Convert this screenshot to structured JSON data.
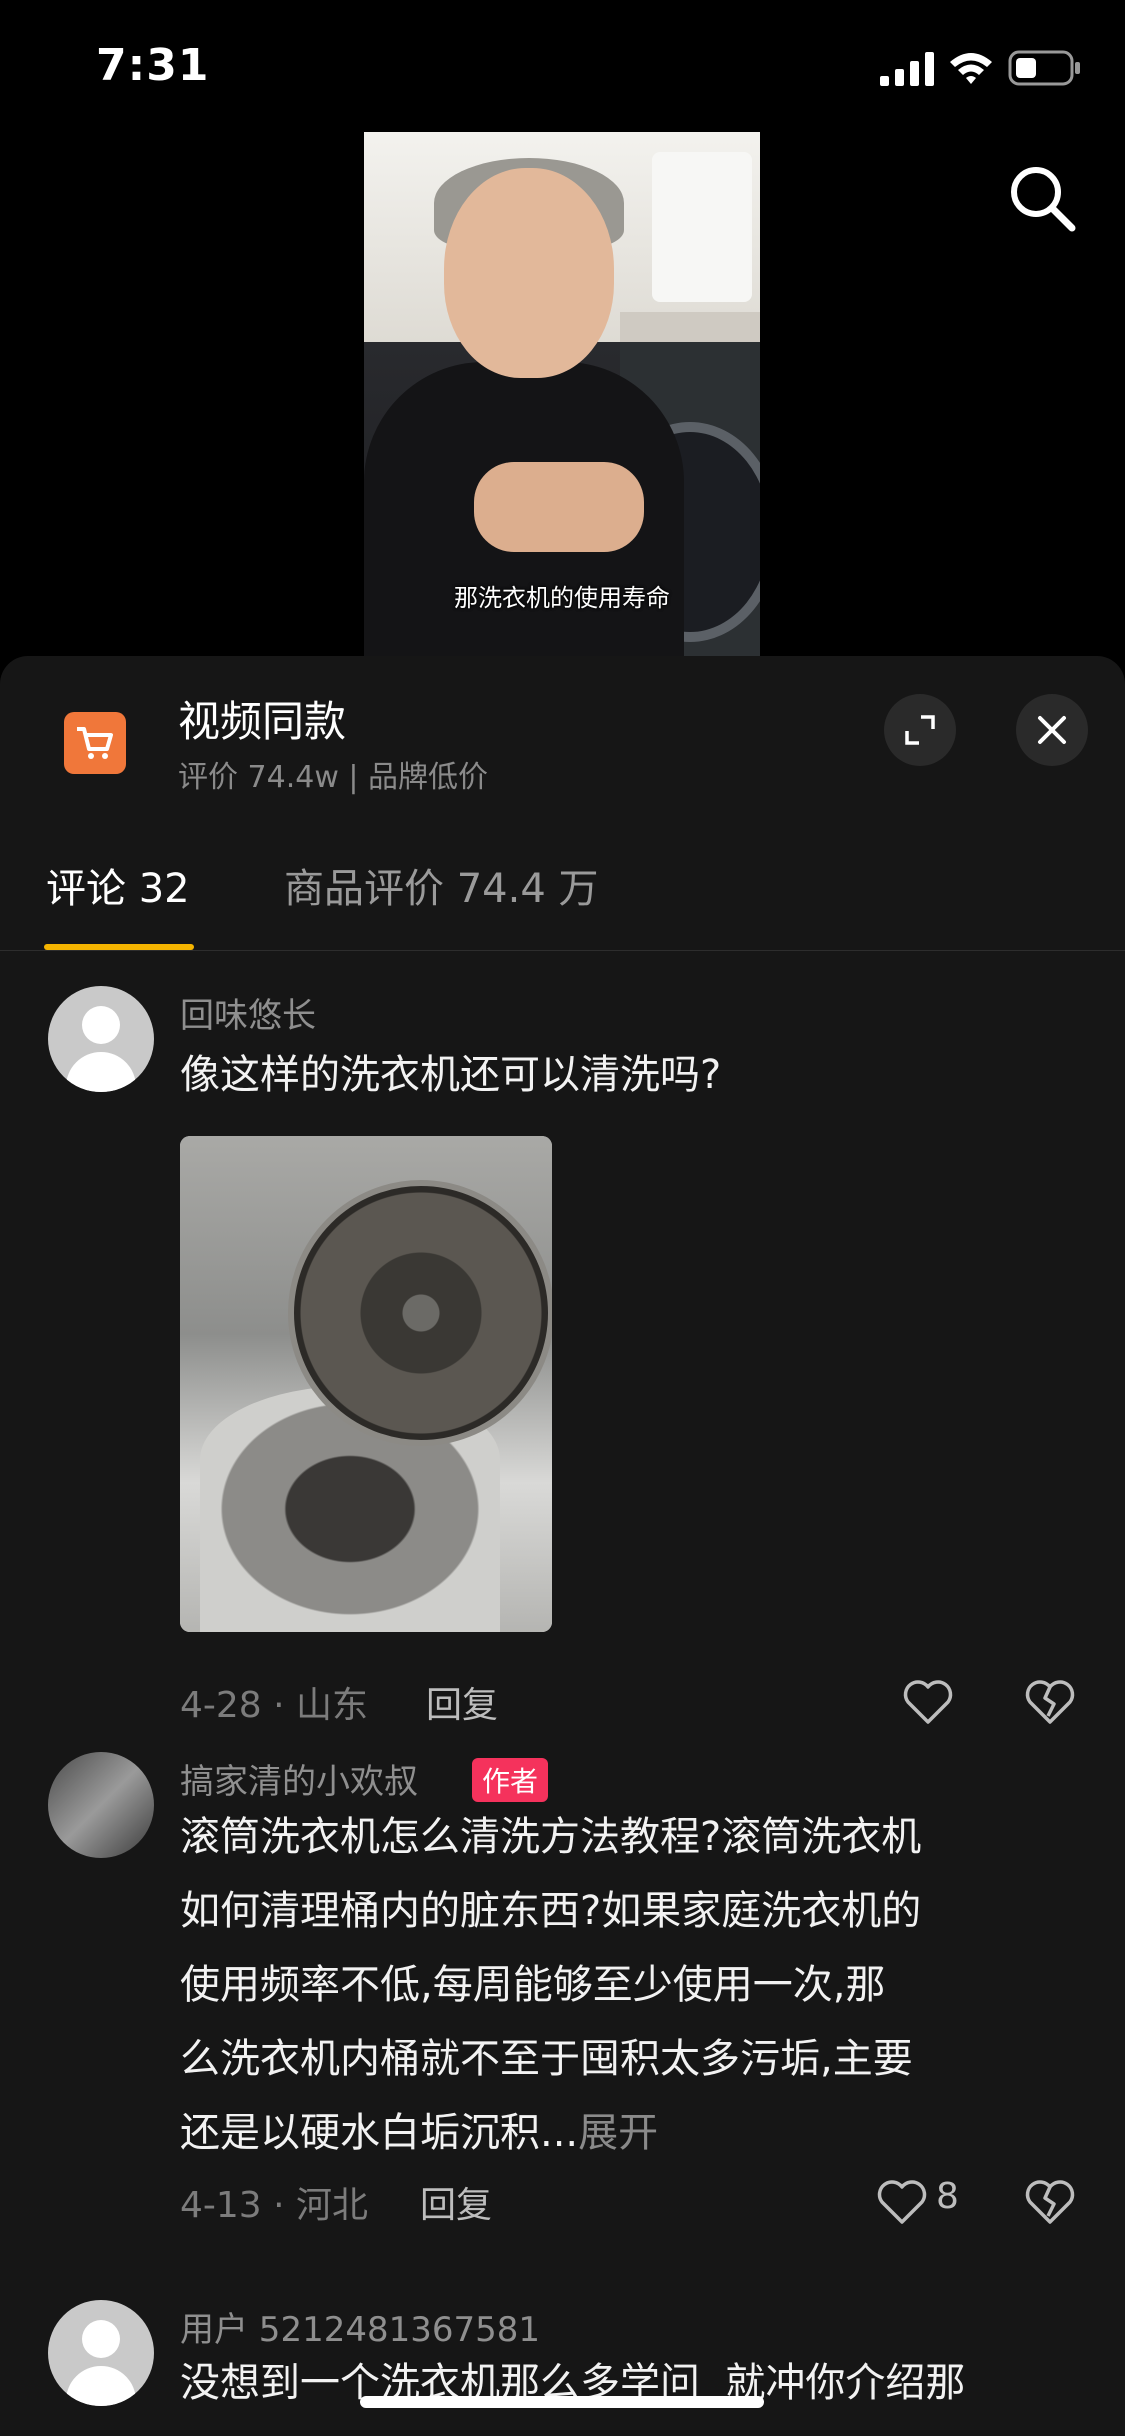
{
  "status_bar": {
    "time": "7:31"
  },
  "video": {
    "subtitle": "那洗衣机的使用寿命"
  },
  "product": {
    "title": "视频同款",
    "subtitle": "评价 74.4w | 品牌低价"
  },
  "tabs": [
    {
      "label": "评论 32",
      "active": true
    },
    {
      "label": "商品评价 74.4 万",
      "active": false
    }
  ],
  "comments": [
    {
      "username": "回味悠长",
      "text": "像这样的洗衣机还可以清洗吗?",
      "meta": "4-28 · 山东",
      "reply_label": "回复",
      "likes": ""
    },
    {
      "username": "搞家清的小欢叔",
      "badge": "作者",
      "text_lines": [
        "滚筒洗衣机怎么清洗方法教程?滚筒洗衣机",
        "如何清理桶内的脏东西?如果家庭洗衣机的",
        "使用频率不低,每周能够至少使用一次,那",
        "么洗衣机内桶就不至于囤积太多污垢,主要",
        "还是以硬水白垢沉积..."
      ],
      "expand_label": "展开",
      "meta": "4-13 · 河北",
      "reply_label": "回复",
      "likes": "8"
    },
    {
      "username": "用户 5212481367581",
      "text": "没想到一个洗衣机那么多学问  就冲你介绍那"
    }
  ],
  "icons": {
    "cart": "shopping-cart-icon",
    "search": "search-icon",
    "expand": "expand-icon",
    "close": "close-icon",
    "like": "heart-icon",
    "dislike": "broken-heart-icon"
  },
  "colors": {
    "accent_tab": "#f5b400",
    "author_badge": "#f5325c",
    "product_icon": "#f0773a"
  }
}
